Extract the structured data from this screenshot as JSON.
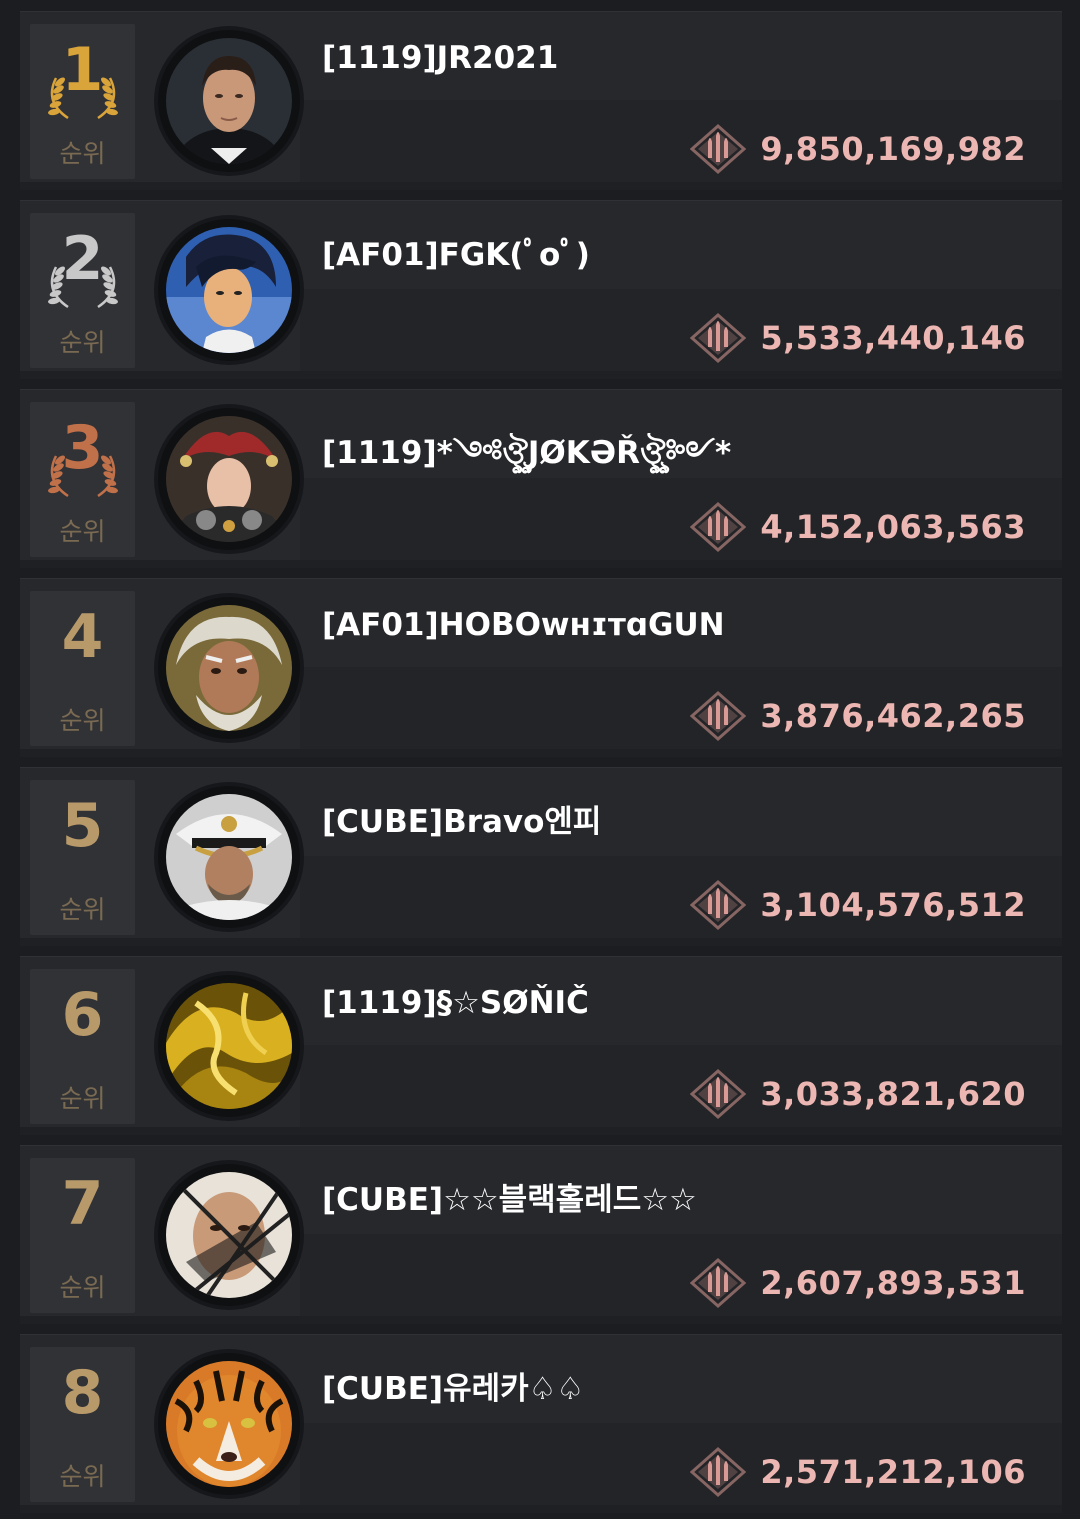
{
  "colors": {
    "gold": "#d9a43a",
    "silver": "#c8c8c8",
    "bronze": "#c0714a",
    "rank_text": "#b89a6a",
    "score_text": "#ecb6b2",
    "score_icon": "#d99a96"
  },
  "rank_suffix": "순위",
  "icon_name": "ammo-bullets-icon",
  "rows": [
    {
      "rank": "1",
      "medal": "gold",
      "name": "[1119]JR2021",
      "score": "9,850,169,982",
      "avatar": "portrait-suit-man"
    },
    {
      "rank": "2",
      "medal": "silver",
      "name": "[AF01]FGK(ﾟoﾟ)",
      "score": "5,533,440,146",
      "avatar": "anime-portrait"
    },
    {
      "rank": "3",
      "medal": "bronze",
      "name": "[1119]*༺ঔৣJØKƏŘঔৣ༻*",
      "score": "4,152,063,563",
      "avatar": "jester-queen"
    },
    {
      "rank": "4",
      "medal": "none",
      "name": "[AF01]HOBOᴡʜɪᴛɑGUN",
      "score": "3,876,462,265",
      "avatar": "old-man-portrait"
    },
    {
      "rank": "5",
      "medal": "none",
      "name": "[CUBE]Bravo엔피",
      "score": "3,104,576,512",
      "avatar": "navy-captain"
    },
    {
      "rank": "6",
      "medal": "none",
      "name": "[1119]§☆SØŇIČ",
      "score": "3,033,821,620",
      "avatar": "gold-abstract"
    },
    {
      "rank": "7",
      "medal": "none",
      "name": "[CUBE]☆☆블랙홀레드☆☆",
      "score": "2,607,893,531",
      "avatar": "shattered-face"
    },
    {
      "rank": "8",
      "medal": "none",
      "name": "[CUBE]유레카♤♤",
      "score": "2,571,212,106",
      "avatar": "tiger"
    }
  ]
}
